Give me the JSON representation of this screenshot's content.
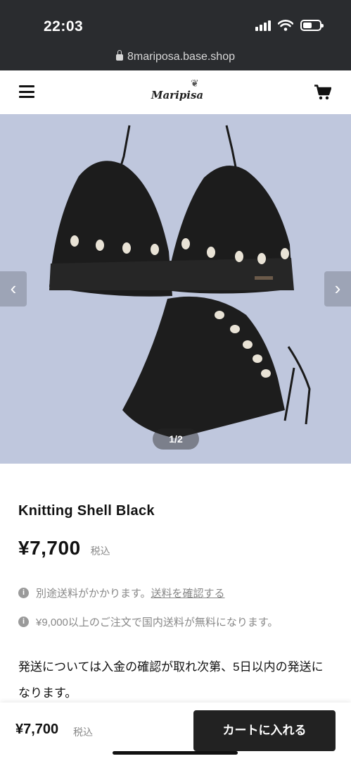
{
  "status_bar": {
    "time": "22:03",
    "icons": [
      "signal-icon",
      "wifi-icon",
      "battery-icon"
    ]
  },
  "browser": {
    "url": "8mariposa.base.shop"
  },
  "header": {
    "logo_text": "Maripisa",
    "icons": [
      "menu-icon",
      "cart-icon"
    ]
  },
  "gallery": {
    "pager_text": "1/2",
    "prev_arrow": "‹",
    "next_arrow": "›",
    "background_color": "#bfc7dd"
  },
  "product": {
    "title": "Knitting Shell Black",
    "price": "¥7,700",
    "tax_label": "税込",
    "shipping_note_prefix": "別途送料がかかります。",
    "shipping_link": "送料を確認する",
    "free_shipping_note": "¥9,000以上のご注文で国内送料が無料になります。",
    "description": "発送については入金の確認が取れ次第、5日以内の発送になります。"
  },
  "bottom_bar": {
    "price": "¥7,700",
    "tax_label": "税込",
    "cart_button_label": "カートに入れる"
  },
  "colors": {
    "dark_bar": "#2a2c2f",
    "button": "#222222",
    "muted_text": "#888888"
  }
}
